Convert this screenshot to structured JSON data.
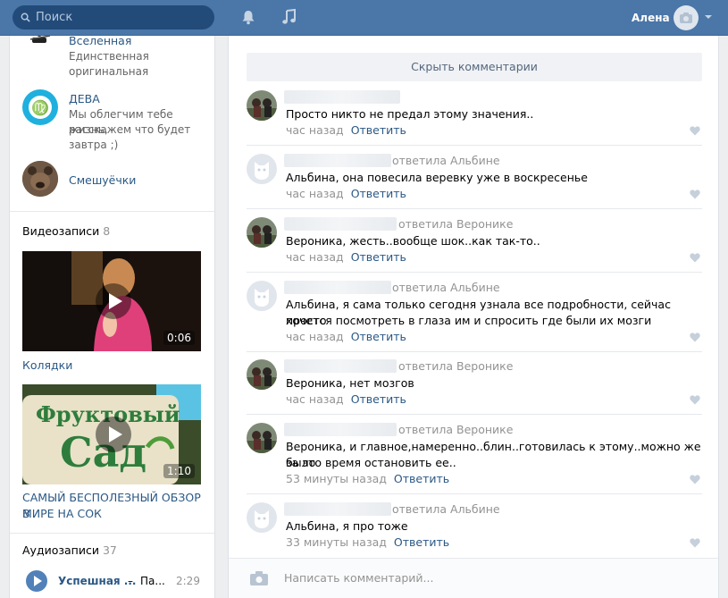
{
  "header": {
    "search_placeholder": "Поиск",
    "user_name": "Алена",
    "icons": [
      "search-icon",
      "bell-icon",
      "music-icon",
      "camera-icon",
      "chevron-down-icon"
    ]
  },
  "left": {
    "groups": [
      {
        "name": "Вселенная",
        "desc_line1": "Единственная",
        "desc_line2": "оригинальная"
      },
      {
        "name": "ДЕВА",
        "desc_line1": "Мы облегчим тебе жизнь,",
        "desc_line2": "расскажем что будет",
        "desc_line3": "завтра ;)"
      },
      {
        "name": "Смешуёчки"
      }
    ],
    "videos": {
      "title": "Видеозаписи",
      "count": "8",
      "items": [
        {
          "title": "Колядки",
          "duration": "0:06"
        },
        {
          "title_line1": "САМЫЙ БЕСПОЛЕЗНЫЙ ОБЗОР В",
          "title_line2": "МИРЕ НА СОК",
          "duration": "1:10",
          "thumb_text1": "Фруктовый",
          "thumb_text2": "Сад"
        }
      ]
    },
    "audios": {
      "title": "Аудиозаписи",
      "count": "37",
      "items": [
        {
          "artist": "Успешная ...",
          "dash": "–",
          "title": "Па...",
          "time": "2:29"
        }
      ]
    }
  },
  "main": {
    "hide_comments": "Скрыть комментарии",
    "reply_label": "Ответить",
    "comments": [
      {
        "replied": "",
        "text": "Просто никто не предал этому значения..",
        "time": "час назад"
      },
      {
        "replied": "ответила Альбине",
        "text": "Альбина, она повесила веревку уже в воскресенье",
        "time": "час назад"
      },
      {
        "replied": "ответила Веронике",
        "text": "Вероника, жесть..вообще шок..как так-то..",
        "time": "час назад"
      },
      {
        "replied": "ответила Альбине",
        "text_line1": "Альбина, я сама только сегодня узнала все подробности, сейчас просто",
        "text_line2": "хочется посмотреть в глаза им и спросить где были их мозги",
        "time": "час назад"
      },
      {
        "replied": "ответила Веронике",
        "text": "Вероника, нет мозгов",
        "time": "час назад"
      },
      {
        "replied": "ответила Веронике",
        "text_line1": "Вероника, и главное,намеренно..блин..готовилась к этому..можно же было",
        "text_line2": "за это время остановить ее..",
        "time": "53 минуты назад"
      },
      {
        "replied": "ответила Альбине",
        "text": "Альбина, я про тоже",
        "time": "33 минуты назад"
      }
    ],
    "write_placeholder": "Написать комментарий..."
  }
}
